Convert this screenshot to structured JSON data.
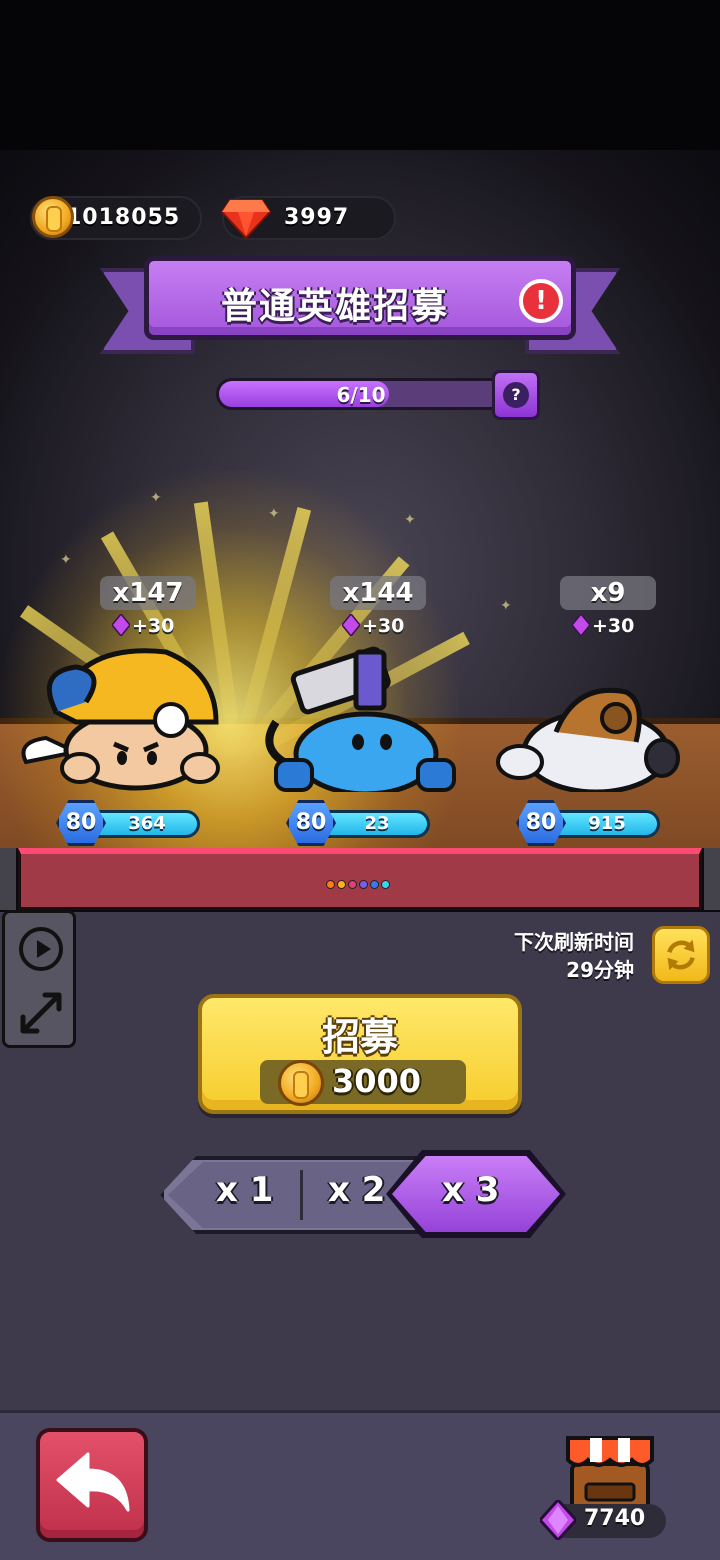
{
  "currency": {
    "coins": "1018055",
    "gems": "3997"
  },
  "title": "普通英雄招募",
  "progress": {
    "label": "6/10",
    "fraction": 0.6
  },
  "heroes": [
    {
      "count": "x147",
      "bonus": "+30",
      "level": "80",
      "power": "364"
    },
    {
      "count": "x144",
      "bonus": "+30",
      "level": "80",
      "power": "23"
    },
    {
      "count": "x9",
      "bonus": "+30",
      "level": "80",
      "power": "915"
    }
  ],
  "refresh": {
    "line1": "下次刷新时间",
    "line2": "29分钟"
  },
  "recruit": {
    "label": "招募",
    "cost": "3000"
  },
  "multipliers": {
    "options": [
      "x 1",
      "x 2",
      "x 3"
    ],
    "selected": "x 3"
  },
  "shop": {
    "gems": "7740"
  },
  "colors": {
    "accent_purple": "#a457dc",
    "recruit_yellow": "#f6cc2d",
    "back_red": "#c0304a",
    "power_cyan": "#21b6e8"
  },
  "icons": [
    "coin-icon",
    "ruby-gem-icon",
    "alert-icon",
    "help-icon",
    "purple-gem-icon",
    "play-icon",
    "expand-icon",
    "refresh-icon",
    "back-arrow-icon",
    "shop-icon"
  ]
}
